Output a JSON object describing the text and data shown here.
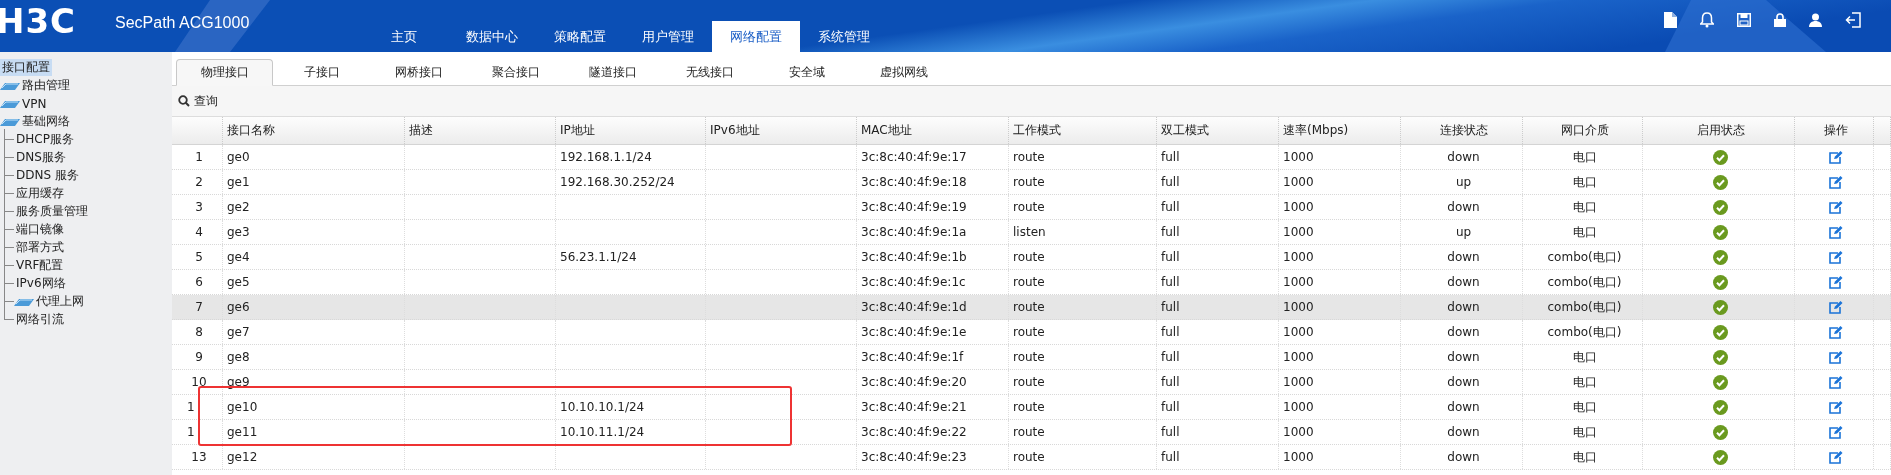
{
  "header": {
    "logo": "H3C",
    "product": "SecPath ACG1000",
    "nav": [
      {
        "label": "主页",
        "selected": false
      },
      {
        "label": "数据中心",
        "selected": false
      },
      {
        "label": "策略配置",
        "selected": false
      },
      {
        "label": "用户管理",
        "selected": false
      },
      {
        "label": "网络配置",
        "selected": true
      },
      {
        "label": "系统管理",
        "selected": false
      }
    ],
    "tools": [
      {
        "kind": "file"
      },
      {
        "kind": "bell"
      },
      {
        "kind": "save"
      },
      {
        "kind": "lock"
      },
      {
        "kind": "user"
      },
      {
        "kind": "logout"
      }
    ]
  },
  "sidebar": {
    "items": [
      {
        "label": "接口配置",
        "selected": true,
        "kind": "plain"
      },
      {
        "label": "路由管理",
        "selected": false,
        "kind": "folder"
      },
      {
        "label": "VPN",
        "selected": false,
        "kind": "folder"
      },
      {
        "label": "基础网络",
        "selected": false,
        "kind": "folder",
        "expanded": true,
        "children": [
          {
            "label": "DHCP服务",
            "selected": false,
            "kind": "leaf"
          },
          {
            "label": "DNS服务",
            "selected": false,
            "kind": "leaf"
          },
          {
            "label": "DDNS 服务",
            "selected": false,
            "kind": "leaf"
          },
          {
            "label": "应用缓存",
            "selected": false,
            "kind": "leaf"
          },
          {
            "label": "服务质量管理",
            "selected": false,
            "kind": "leaf"
          },
          {
            "label": "端口镜像",
            "selected": false,
            "kind": "leaf"
          },
          {
            "label": "部署方式",
            "selected": false,
            "kind": "leaf"
          },
          {
            "label": "VRF配置",
            "selected": false,
            "kind": "leaf"
          },
          {
            "label": "IPv6网络",
            "selected": false,
            "kind": "leaf"
          },
          {
            "label": "代理上网",
            "selected": false,
            "kind": "folder"
          },
          {
            "label": "网络引流",
            "selected": false,
            "kind": "leaf"
          }
        ]
      }
    ]
  },
  "tabs": [
    {
      "label": "物理接口",
      "selected": true
    },
    {
      "label": "子接口",
      "selected": false
    },
    {
      "label": "网桥接口",
      "selected": false
    },
    {
      "label": "聚合接口",
      "selected": false
    },
    {
      "label": "隧道接口",
      "selected": false
    },
    {
      "label": "无线接口",
      "selected": false
    },
    {
      "label": "安全域",
      "selected": false
    },
    {
      "label": "虚拟网线",
      "selected": false
    }
  ],
  "query": {
    "label": "查询"
  },
  "table": {
    "columns": [
      "接口名称",
      "描述",
      "IP地址",
      "IPv6地址",
      "MAC地址",
      "工作模式",
      "双工模式",
      "速率(Mbps)",
      "连接状态",
      "网口介质",
      "启用状态",
      "操作"
    ],
    "rows": [
      {
        "index": "1",
        "name": "ge0",
        "ip": "192.168.1.1/24",
        "mac": "3c:8c:40:4f:9e:17",
        "mode": "route",
        "duplex": "full",
        "speed": "1000",
        "link": "down",
        "medium": "电口",
        "enabled": true,
        "selected": false,
        "outlined": false
      },
      {
        "index": "2",
        "name": "ge1",
        "ip": "192.168.30.252/24",
        "mac": "3c:8c:40:4f:9e:18",
        "mode": "route",
        "duplex": "full",
        "speed": "1000",
        "link": "up",
        "medium": "电口",
        "enabled": true,
        "selected": false,
        "outlined": false
      },
      {
        "index": "3",
        "name": "ge2",
        "mac": "3c:8c:40:4f:9e:19",
        "mode": "route",
        "duplex": "full",
        "speed": "1000",
        "link": "down",
        "medium": "电口",
        "enabled": true,
        "selected": false,
        "outlined": false
      },
      {
        "index": "4",
        "name": "ge3",
        "mac": "3c:8c:40:4f:9e:1a",
        "mode": "listen",
        "duplex": "full",
        "speed": "1000",
        "link": "up",
        "medium": "电口",
        "enabled": true,
        "selected": false,
        "outlined": false
      },
      {
        "index": "5",
        "name": "ge4",
        "ip": "56.23.1.1/24",
        "mac": "3c:8c:40:4f:9e:1b",
        "mode": "route",
        "duplex": "full",
        "speed": "1000",
        "link": "down",
        "medium": "combo(电口)",
        "enabled": true,
        "selected": false,
        "outlined": false
      },
      {
        "index": "6",
        "name": "ge5",
        "mac": "3c:8c:40:4f:9e:1c",
        "mode": "route",
        "duplex": "full",
        "speed": "1000",
        "link": "down",
        "medium": "combo(电口)",
        "enabled": true,
        "selected": false,
        "outlined": false
      },
      {
        "index": "7",
        "name": "ge6",
        "mac": "3c:8c:40:4f:9e:1d",
        "mode": "route",
        "duplex": "full",
        "speed": "1000",
        "link": "down",
        "medium": "combo(电口)",
        "enabled": true,
        "selected": true,
        "outlined": false
      },
      {
        "index": "8",
        "name": "ge7",
        "mac": "3c:8c:40:4f:9e:1e",
        "mode": "route",
        "duplex": "full",
        "speed": "1000",
        "link": "down",
        "medium": "combo(电口)",
        "enabled": true,
        "selected": false,
        "outlined": false
      },
      {
        "index": "9",
        "name": "ge8",
        "mac": "3c:8c:40:4f:9e:1f",
        "mode": "route",
        "duplex": "full",
        "speed": "1000",
        "link": "down",
        "medium": "电口",
        "enabled": true,
        "selected": false,
        "outlined": false
      },
      {
        "index": "10",
        "name": "ge9",
        "mac": "3c:8c:40:4f:9e:20",
        "mode": "route",
        "duplex": "full",
        "speed": "1000",
        "link": "down",
        "medium": "电口",
        "enabled": true,
        "selected": false,
        "outlined": false
      },
      {
        "index": "1",
        "name": "ge10",
        "ip": "10.10.10.1/24",
        "mac": "3c:8c:40:4f:9e:21",
        "mode": "route",
        "duplex": "full",
        "speed": "1000",
        "link": "down",
        "medium": "电口",
        "enabled": true,
        "selected": false,
        "outlined": true
      },
      {
        "index": "1",
        "name": "ge11",
        "ip": "10.10.11.1/24",
        "mac": "3c:8c:40:4f:9e:22",
        "mode": "route",
        "duplex": "full",
        "speed": "1000",
        "link": "down",
        "medium": "电口",
        "enabled": true,
        "selected": false,
        "outlined": true
      },
      {
        "index": "13",
        "name": "ge12",
        "mac": "3c:8c:40:4f:9e:23",
        "mode": "route",
        "duplex": "full",
        "speed": "1000",
        "link": "down",
        "medium": "电口",
        "enabled": true,
        "selected": false,
        "outlined": false
      }
    ]
  }
}
